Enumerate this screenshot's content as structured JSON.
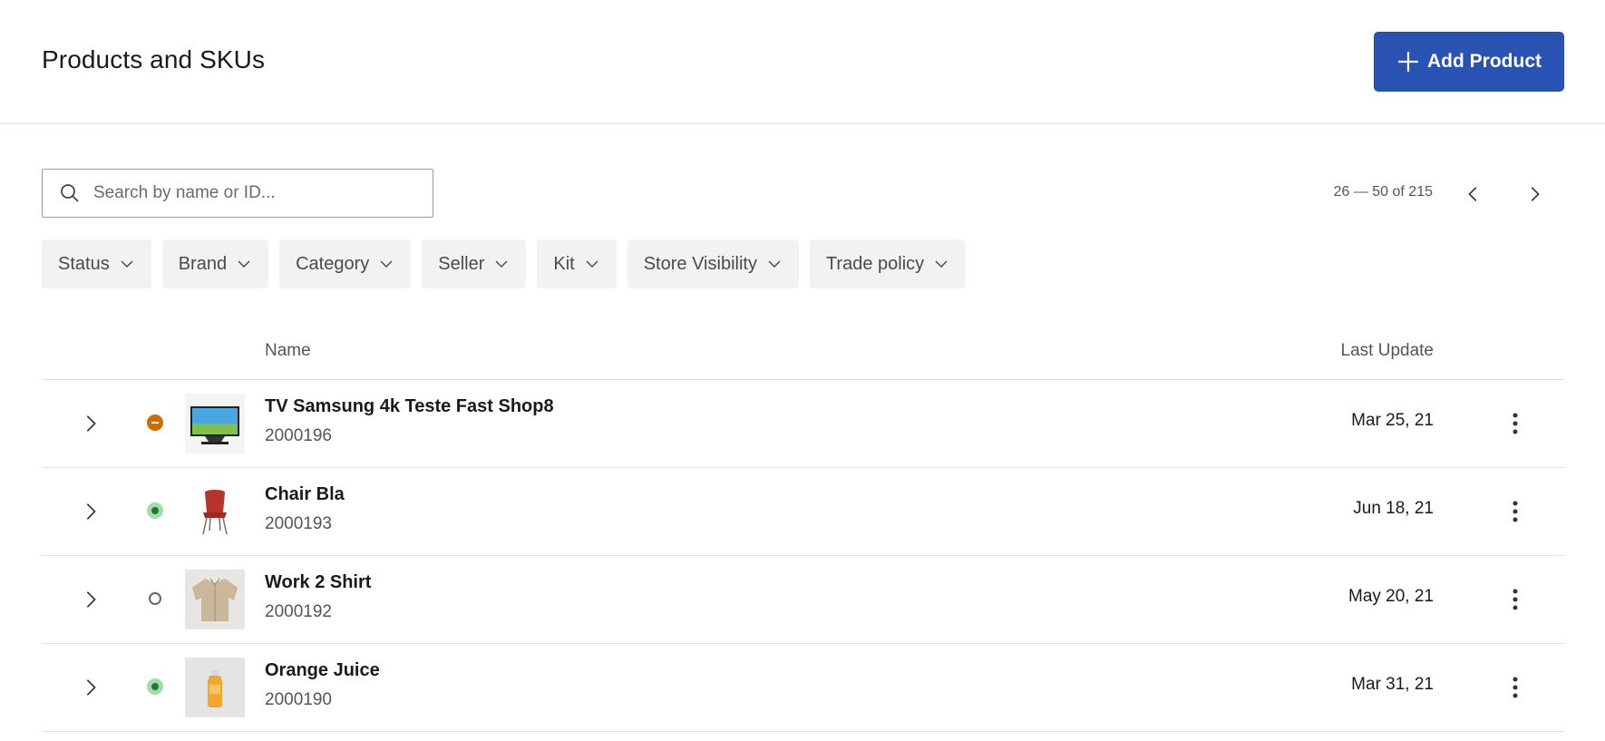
{
  "header": {
    "title": "Products and SKUs",
    "add_button_label": "Add Product"
  },
  "search": {
    "placeholder": "Search by name or ID...",
    "value": ""
  },
  "pagination": {
    "range_text": "26 — 50 of 215"
  },
  "filters": [
    "Status",
    "Brand",
    "Category",
    "Seller",
    "Kit",
    "Store Visibility",
    "Trade policy"
  ],
  "table": {
    "columns": {
      "name": "Name",
      "last_update": "Last Update"
    },
    "rows": [
      {
        "name": "TV Samsung 4k Teste Fast Shop8",
        "id": "2000196",
        "last_update": "Mar 25, 21",
        "status": "inactive",
        "thumb": "tv-image"
      },
      {
        "name": "Chair Bla",
        "id": "2000193",
        "last_update": "Jun 18, 21",
        "status": "active",
        "thumb": "chair-image"
      },
      {
        "name": "Work 2 Shirt",
        "id": "2000192",
        "last_update": "May 20, 21",
        "status": "draft",
        "thumb": "shirt-image"
      },
      {
        "name": "Orange Juice",
        "id": "2000190",
        "last_update": "Mar 31, 21",
        "status": "active",
        "thumb": "juice-image"
      }
    ]
  },
  "colors": {
    "primary_button": "#2953b2",
    "status_inactive": "#d26a00",
    "status_active": "#1e7a33",
    "status_active_bg": "#a4dca8"
  },
  "icons": {
    "add": "plus-icon",
    "search": "search-icon",
    "prev": "chevron-left-icon",
    "next": "chevron-right-icon",
    "filter": "chevron-down-icon",
    "expand": "chevron-right-icon",
    "menu": "kebab-menu-icon"
  }
}
